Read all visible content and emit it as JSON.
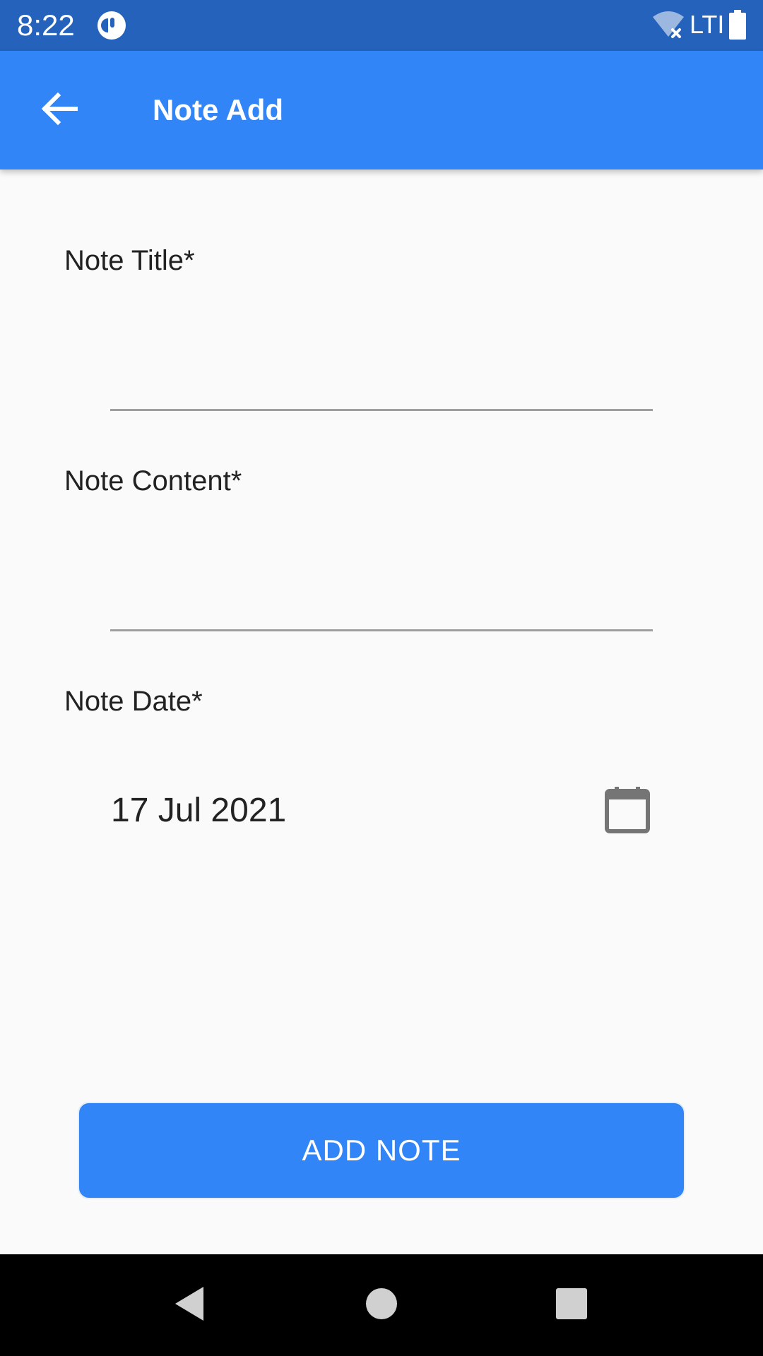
{
  "status_bar": {
    "time": "8:22",
    "network_label": "LTI",
    "background_color": "#2462bc",
    "icons": [
      "app-notification-icon",
      "wifi-off-icon",
      "battery-icon"
    ]
  },
  "app_bar": {
    "title": "Note Add",
    "back_icon": "arrow-back-icon",
    "background_color": "#3185f6"
  },
  "form": {
    "title_field": {
      "label": "Note Title*",
      "value": "",
      "placeholder": ""
    },
    "content_field": {
      "label": "Note Content*",
      "value": "",
      "placeholder": ""
    },
    "date_field": {
      "label": "Note Date*",
      "value": "17 Jul 2021",
      "icon": "calendar-icon"
    }
  },
  "actions": {
    "add_note_label": "ADD NOTE"
  },
  "nav_bar": {
    "icons": [
      "nav-back-icon",
      "nav-home-icon",
      "nav-recents-icon"
    ]
  }
}
